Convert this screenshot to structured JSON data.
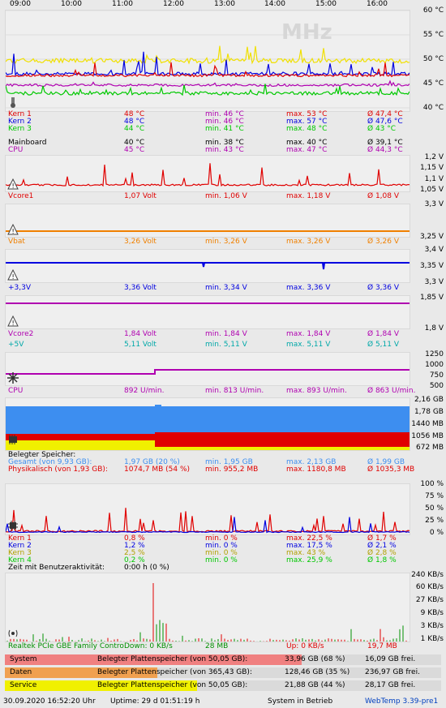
{
  "times": [
    "09:00",
    "10:00",
    "11:00",
    "12:00",
    "13:00",
    "14:00",
    "15:00",
    "16:00"
  ],
  "colors": {
    "red": "#e00000",
    "blue": "#0000e0",
    "green": "#00c800",
    "yellow": "#f0e000",
    "purple": "#b000b0",
    "orange": "#f08000",
    "cyan": "#00a8a8",
    "sky": "#3d8ef0"
  },
  "temp": {
    "axis": [
      "60 °C",
      "55 °C",
      "50 °C",
      "45 °C",
      "40 °C"
    ],
    "watermark": "MHz",
    "rows": [
      {
        "name": "Kern 1",
        "cur": "48 °C",
        "min": "min. 46 °C",
        "max": "max. 53 °C",
        "avg": "Ø 47,4 °C"
      },
      {
        "name": "Kern 2",
        "cur": "48 °C",
        "min": "min. 46 °C",
        "max": "max. 57 °C",
        "avg": "Ø 47,6 °C"
      },
      {
        "name": "Kern 3",
        "cur": "44 °C",
        "min": "min. 41 °C",
        "max": "max. 48 °C",
        "avg": "Ø 43 °C"
      },
      {
        "name": "Mainboard",
        "cur": "40 °C",
        "min": "min. 38 °C",
        "max": "max. 40 °C",
        "avg": "Ø 39,1 °C"
      },
      {
        "name": "CPU",
        "cur": "45 °C",
        "min": "min. 43 °C",
        "max": "max. 47 °C",
        "avg": "Ø 44,3 °C"
      }
    ]
  },
  "vcore": {
    "axis": [
      "1,2 V",
      "1,15 V",
      "1,1 V",
      "1,05 V"
    ],
    "row": {
      "name": "Vcore1",
      "cur": "1,07 Volt",
      "min": "min. 1,06 V",
      "max": "max. 1,18 V",
      "avg": "Ø 1,08 V"
    }
  },
  "vbat": {
    "axis": [
      "3,3 V",
      "3,25 V"
    ],
    "row": {
      "name": "Vbat",
      "cur": "3,26 Volt",
      "min": "min. 3,26 V",
      "max": "max. 3,26 V",
      "avg": "Ø 3,26 V"
    }
  },
  "v33": {
    "axis": [
      "3,4 V",
      "3,35 V",
      "3,3 V"
    ],
    "row": {
      "name": "+3,3V",
      "cur": "3,36 Volt",
      "min": "min. 3,34 V",
      "max": "max. 3,36 V",
      "avg": "Ø 3,36 V"
    }
  },
  "v2": {
    "axis": [
      "1,85 V",
      "1,8 V"
    ],
    "rows": [
      {
        "name": "Vcore2",
        "cur": "1,84 Volt",
        "min": "min. 1,84 V",
        "max": "max. 1,84 V",
        "avg": "Ø 1,84 V"
      },
      {
        "name": "+5V",
        "cur": "5,11 Volt",
        "min": "min. 5,11 V",
        "max": "max. 5,11 V",
        "avg": "Ø 5,11 V"
      }
    ]
  },
  "fan": {
    "axis": [
      "1250",
      "1000",
      "750",
      "500"
    ],
    "row": {
      "name": "CPU",
      "cur": "892 U/min.",
      "min": "min. 813 U/min.",
      "max": "max. 893 U/min.",
      "avg": "Ø 863 U/min."
    }
  },
  "mem": {
    "axis": [
      "2,16 GB",
      "1,78 GB",
      "1440 MB",
      "1056 MB",
      "672 MB"
    ],
    "header": "Belegter Speicher:",
    "rows": [
      {
        "name": "Gesamt (von 9,93 GB):",
        "cur": "1,97 GB (20 %)",
        "min": "min. 1,95 GB",
        "max": "max. 2,13 GB",
        "avg": "Ø 1,99 GB"
      },
      {
        "name": "Physikalisch (von 1,93 GB):",
        "cur": "1074,7 MB (54 %)",
        "min": "min. 955,2 MB",
        "max": "max. 1180,8 MB",
        "avg": "Ø 1035,3 MB"
      }
    ]
  },
  "cpu": {
    "axis": [
      "100 %",
      "75 %",
      "50 %",
      "25 %",
      "0 %"
    ],
    "rows": [
      {
        "name": "Kern 1",
        "cur": "0,8 %",
        "min": "min. 0 %",
        "max": "max. 22,5 %",
        "avg": "Ø 1,7 %"
      },
      {
        "name": "Kern 2",
        "cur": "1,2 %",
        "min": "min. 0 %",
        "max": "max. 17,5 %",
        "avg": "Ø 2,1 %"
      },
      {
        "name": "Kern 3",
        "cur": "2,5 %",
        "min": "min. 0 %",
        "max": "max. 43 %",
        "avg": "Ø 2,8 %"
      },
      {
        "name": "Kern 4",
        "cur": "0,2 %",
        "min": "min. 0 %",
        "max": "max. 25,9 %",
        "avg": "Ø 1,8 %"
      }
    ],
    "activity_label": "Zeit mit Benutzeraktivität:",
    "activity_value": "0:00 h (0 %)"
  },
  "net": {
    "axis": [
      "240 KB/s",
      "60 KB/s",
      "27 KB/s",
      "9 KB/s",
      "3 KB/s",
      "1 KB/s"
    ],
    "name": "Realtek PCIe GBE Family Contro",
    "down": "Down: 0 KB/s",
    "down_total": "28 MB",
    "up": "Up: 0 KB/s",
    "up_total": "19,7 MB"
  },
  "disks": [
    {
      "name": "System",
      "label": "Belegter Plattenspeicher (von 50,05 GB):",
      "used": "33,96 GB (68 %)",
      "free": "16,09 GB frei.",
      "used_pct": 68,
      "color": "#f08080"
    },
    {
      "name": "Daten",
      "label": "Belegter Plattenspeicher (von 365,43 GB):",
      "used": "128,46 GB (35 %)",
      "free": "236,97 GB frei.",
      "used_pct": 35,
      "color": "#f0a050"
    },
    {
      "name": "Service",
      "label": "Belegter Plattenspeicher (von 50,05 GB):",
      "used": "21,88 GB (44 %)",
      "free": "28,17 GB frei.",
      "used_pct": 44,
      "color": "#f0f000"
    }
  ],
  "footer": {
    "datetime": "30.09.2020 16:52:20 Uhr",
    "uptime": "Uptime: 29 d 01:51:19 h",
    "status": "System in Betrieb",
    "app": "WebTemp 3.39-pre1"
  }
}
